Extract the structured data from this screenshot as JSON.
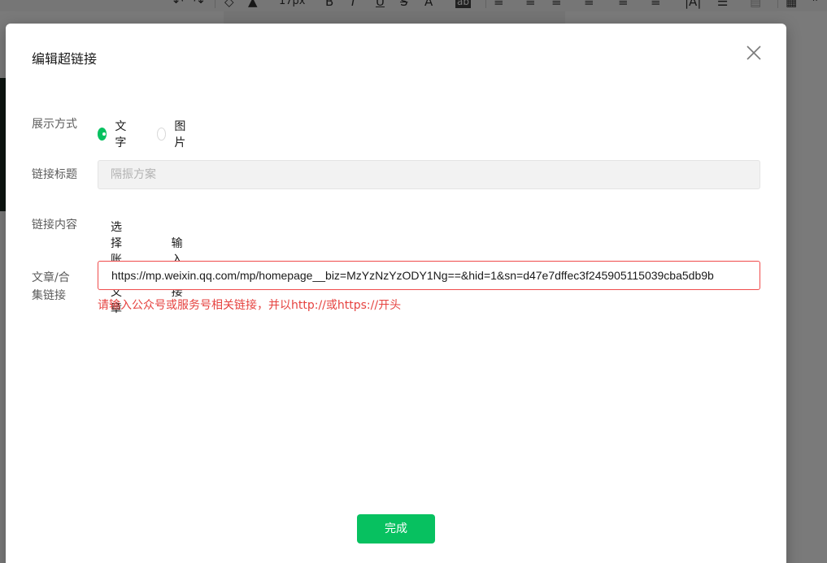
{
  "background_toolbar": {
    "font_size_value": "17px",
    "items": [
      "↶",
      "↷",
      "⌫",
      "▲",
      "17px",
      "B",
      "I",
      "U",
      "S",
      "A",
      "ab"
    ]
  },
  "dialog": {
    "title": "编辑超链接",
    "close_icon": "close-icon",
    "display_mode": {
      "label": "展示方式",
      "options": [
        {
          "label": "文字",
          "checked": true
        },
        {
          "label": "图片",
          "checked": false
        }
      ]
    },
    "link_title": {
      "label": "链接标题",
      "placeholder": "隔振方案"
    },
    "link_content": {
      "label": "链接内容",
      "options": [
        {
          "label": "选择账号文章",
          "checked": false
        },
        {
          "label": "输入链接",
          "checked": true
        }
      ]
    },
    "article_link": {
      "label_line1": "文章/合",
      "label_line2": "集链接",
      "value": "https://mp.weixin.qq.com/mp/homepage__biz=MzYzNzYzODY1Ng==&hid=1&sn=d47e7dffec3f245905115039cba5db9b",
      "error": "请输入公众号或服务号相关链接，并以http://或https://开头"
    },
    "done_label": "完成"
  },
  "colors": {
    "accent": "#07c160",
    "error": "#e64340",
    "error_border": "#f04b4b"
  }
}
